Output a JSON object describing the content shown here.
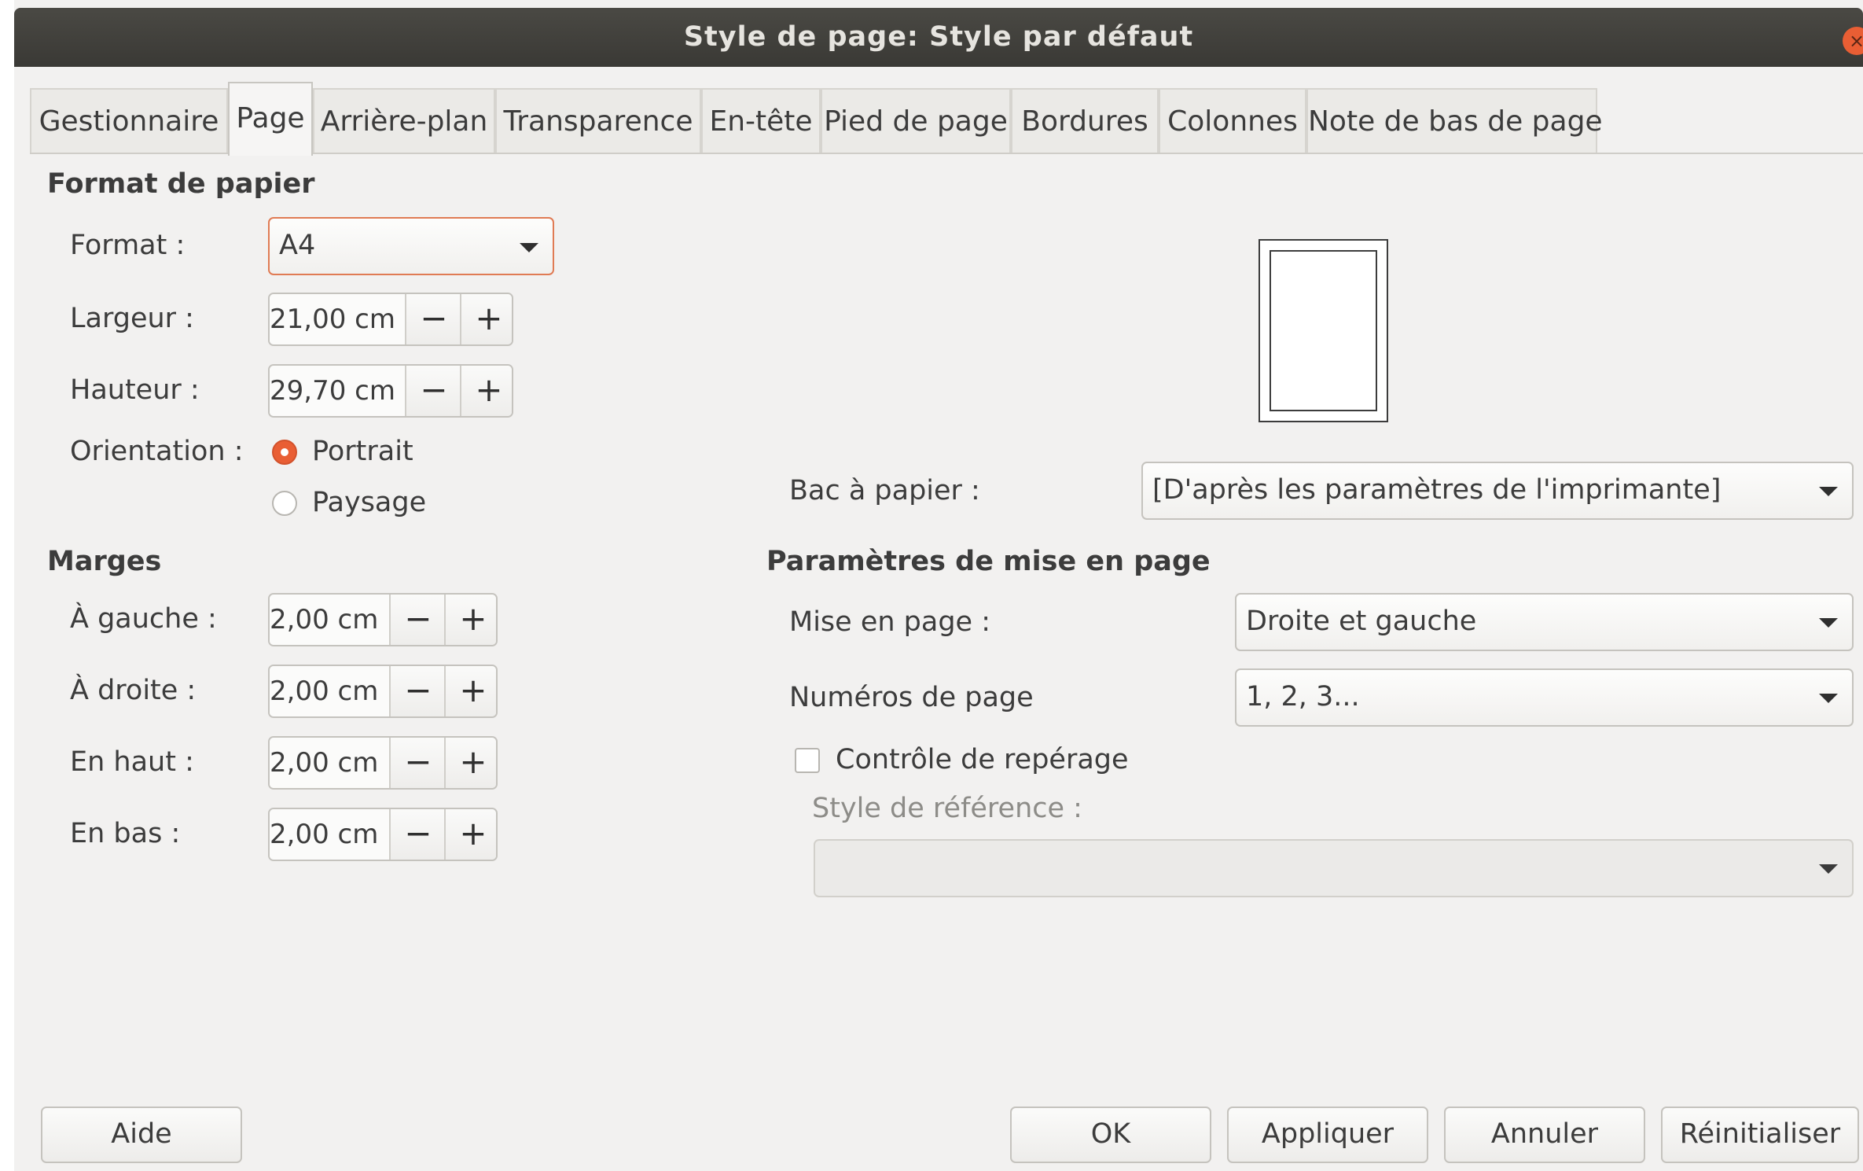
{
  "window": {
    "title": "Style de page: Style par défaut",
    "close_icon": "×"
  },
  "tabs": [
    {
      "label": "Gestionnaire"
    },
    {
      "label": "Page"
    },
    {
      "label": "Arrière-plan"
    },
    {
      "label": "Transparence"
    },
    {
      "label": "En-tête"
    },
    {
      "label": "Pied de page"
    },
    {
      "label": "Bordures"
    },
    {
      "label": "Colonnes"
    },
    {
      "label": "Note de bas de page"
    }
  ],
  "paper_format": {
    "heading": "Format de papier",
    "format_label": "Format :",
    "format_value": "A4",
    "width_label": "Largeur :",
    "width_value": "21,00 cm",
    "height_label": "Hauteur :",
    "height_value": "29,70 cm",
    "orientation_label": "Orientation :",
    "portrait_label": "Portrait",
    "landscape_label": "Paysage",
    "paper_tray_label": "Bac à papier :",
    "paper_tray_value": "[D'après les paramètres de l'imprimante]"
  },
  "margins": {
    "heading": "Marges",
    "left_label": "À gauche :",
    "left_value": "2,00 cm",
    "right_label": "À droite :",
    "right_value": "2,00 cm",
    "top_label": "En haut :",
    "top_value": "2,00 cm",
    "bottom_label": "En bas :",
    "bottom_value": "2,00 cm"
  },
  "layout_settings": {
    "heading": "Paramètres de mise en page",
    "layout_label": "Mise en page :",
    "layout_value": "Droite et gauche",
    "page_numbers_label": "Numéros de page",
    "page_numbers_value": "1, 2, 3...",
    "register_true_label": "Contrôle de repérage",
    "reference_style_label": "Style de référence :",
    "reference_style_value": ""
  },
  "spin": {
    "minus": "−",
    "plus": "+"
  },
  "buttons": {
    "help": "Aide",
    "ok": "OK",
    "apply": "Appliquer",
    "cancel": "Annuler",
    "reset": "Réinitialiser"
  },
  "colors": {
    "accent": "#e95e34",
    "titlebar": "#3f3e3a",
    "background": "#f2f1f0"
  }
}
